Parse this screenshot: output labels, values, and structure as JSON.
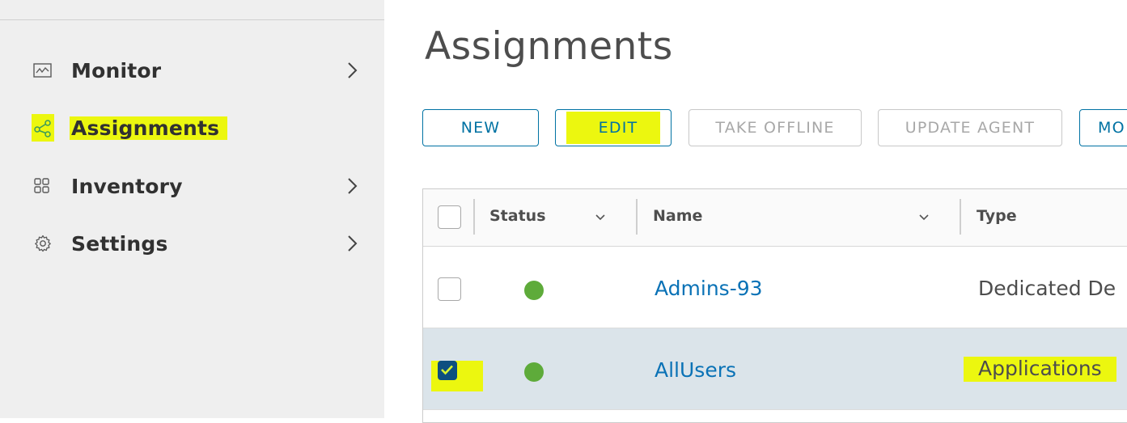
{
  "sidebar": {
    "items": [
      {
        "label": "Monitor",
        "icon": "monitor-icon",
        "has_chevron": true
      },
      {
        "label": "Assignments",
        "icon": "share-nodes-icon",
        "has_chevron": false,
        "selected": true
      },
      {
        "label": "Inventory",
        "icon": "grid-icon",
        "has_chevron": true
      },
      {
        "label": "Settings",
        "icon": "gear-icon",
        "has_chevron": true
      }
    ]
  },
  "main": {
    "title": "Assignments",
    "toolbar": {
      "new_label": "NEW",
      "edit_label": "EDIT",
      "take_offline_label": "TAKE OFFLINE",
      "update_agent_label": "UPDATE AGENT",
      "more_label": "MO"
    },
    "grid": {
      "columns": {
        "status": "Status",
        "name": "Name",
        "type": "Type"
      },
      "rows": [
        {
          "name": "Admins-93",
          "type": "Dedicated De",
          "status": "green",
          "selected": false
        },
        {
          "name": "AllUsers",
          "type": "Applications",
          "status": "green",
          "selected": true
        }
      ]
    }
  },
  "colors": {
    "accent": "#0072a3",
    "highlight": "#ecf70f",
    "status_green": "#5eab3a",
    "selected_row": "#dbe4ea",
    "link": "#0a72b6"
  }
}
